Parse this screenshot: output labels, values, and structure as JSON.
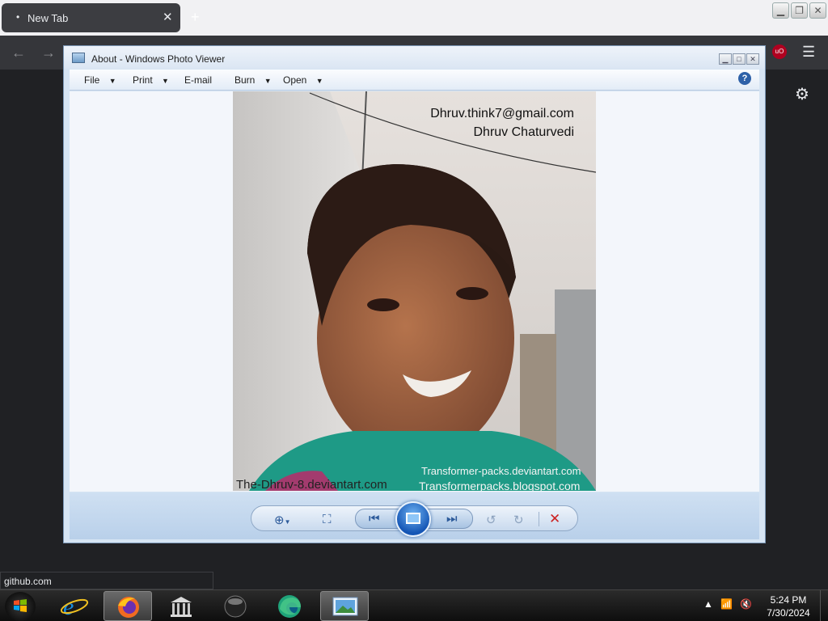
{
  "browser": {
    "tab_title": "New Tab",
    "tab_close": "✕",
    "new_tab": "+",
    "status_url": "github.com",
    "extension_badge": "uO"
  },
  "photo_viewer": {
    "title": "About - Windows Photo Viewer",
    "menu": [
      {
        "label": "File",
        "has_dropdown": true
      },
      {
        "label": "Print",
        "has_dropdown": true
      },
      {
        "label": "E-mail",
        "has_dropdown": false
      },
      {
        "label": "Burn",
        "has_dropdown": true
      },
      {
        "label": "Open",
        "has_dropdown": true
      }
    ],
    "help_label": "?",
    "photo": {
      "email": "Dhruv.think7@gmail.com",
      "name": "Dhruv Chaturvedi",
      "credit_left": "The-Dhruv-8.deviantart.com",
      "credit_right_1": "Transformer-packs.deviantart.com",
      "credit_right_2": "Transformerpacks.blogspot.com"
    },
    "toolbar_icons": [
      "zoom-icon",
      "actual-size-icon",
      "previous-icon",
      "slideshow-icon",
      "next-icon",
      "rotate-left-icon",
      "rotate-right-icon",
      "delete-icon"
    ]
  },
  "taskbar": {
    "apps": [
      "internet-explorer",
      "firefox",
      "library",
      "media-player",
      "edge",
      "photo-viewer"
    ],
    "active_app": "photo-viewer",
    "time": "5:24 PM",
    "date": "7/30/2024"
  },
  "colors": {
    "browser_dark": "#35363a",
    "viewer_frame": "#d6e4f3",
    "delete_red": "#cc2222",
    "taskbar": "#1a1a1a"
  }
}
